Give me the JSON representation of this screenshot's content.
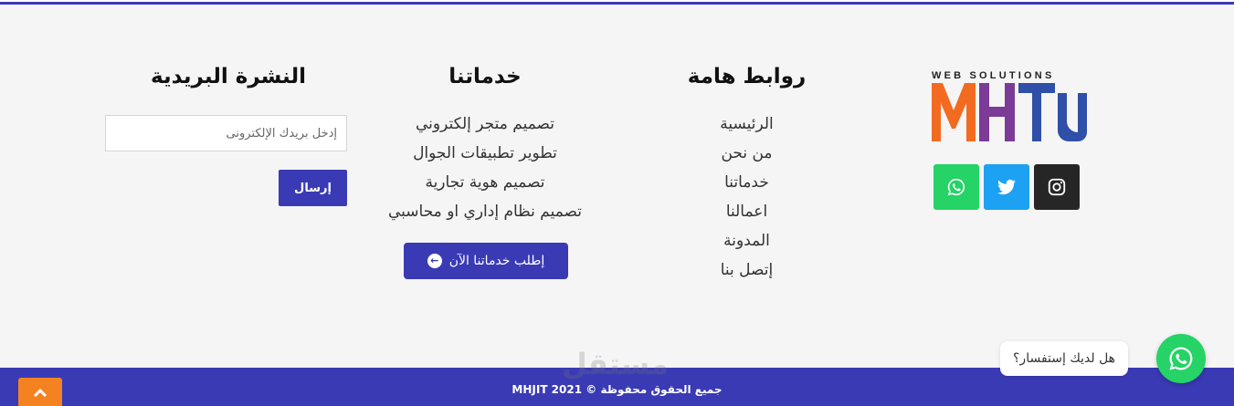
{
  "footer": {
    "newsletter": {
      "heading": "النشرة البريدية",
      "email_placeholder": "إدخل بريدك الإلكترونى",
      "send_label": "إرسال"
    },
    "services": {
      "heading": "خدماتنا",
      "items": [
        "تصميم متجر إلكتروني",
        "تطوير تطبيقات الجوال",
        "تصميم هوية تجارية",
        "تصميم نظام إداري او محاسبي"
      ],
      "order_button_label": "إطلب خدماتنا الآن"
    },
    "links": {
      "heading": "روابط هامة",
      "items": [
        "الرئيسية",
        "من نحن",
        "خدماتنا",
        "اعمالنا",
        "المدونة",
        "إتصل بنا"
      ]
    },
    "brand": {
      "tagline": "WEB SOLUTIONS",
      "logo_text": "MHIT",
      "socials": [
        "whatsapp-icon",
        "twitter-icon",
        "instagram-icon"
      ]
    }
  },
  "bottom_bar": {
    "copyright": "جميع الحقوق محفوظة © MHJIT 2021",
    "watermark": "مستقل"
  },
  "chat": {
    "prompt": "هل لديك إستفسار؟"
  },
  "colors": {
    "primary": "#3a3ab5",
    "accent_orange": "#f58220",
    "whatsapp": "#25d366",
    "twitter": "#1da1f2",
    "instagram": "#262626"
  }
}
